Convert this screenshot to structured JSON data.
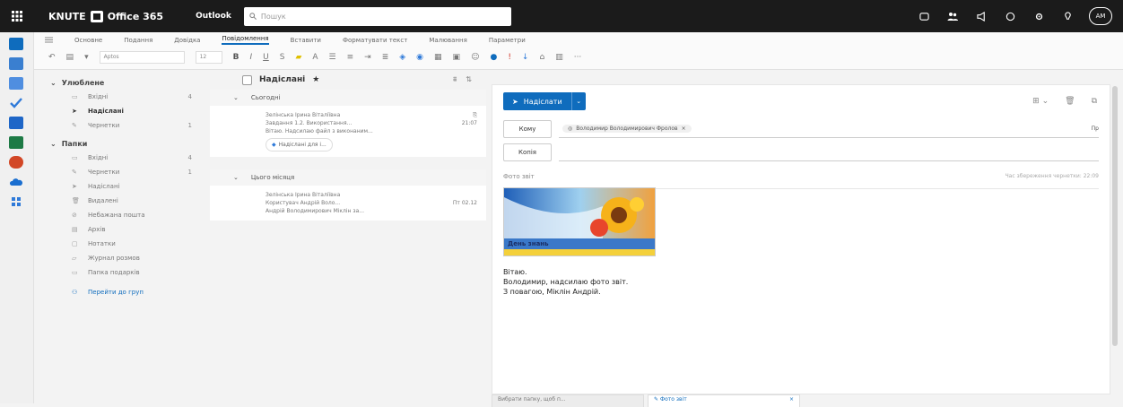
{
  "header": {
    "brand": "KNUTE",
    "suite": "Office 365",
    "app": "Outlook",
    "search_placeholder": "Пошук",
    "avatar": "AM"
  },
  "ribbon": {
    "tabs": [
      "Основне",
      "Подання",
      "Довідка",
      "Повідомлення",
      "Вставити",
      "Форматувати текст",
      "Малювання",
      "Параметри"
    ],
    "active_tab": "Повідомлення",
    "font": "Aptos",
    "size": "12"
  },
  "folders": {
    "favorites_header": "Улюблене",
    "favorites": [
      {
        "label": "Вхідні",
        "count": "4",
        "icon": "inbox-icon"
      },
      {
        "label": "Надіслані",
        "count": "",
        "icon": "send-icon"
      },
      {
        "label": "Чернетки",
        "count": "1",
        "icon": "draft-icon"
      }
    ],
    "folders_header": "Папки",
    "folders": [
      {
        "label": "Вхідні",
        "count": "4",
        "icon": "inbox-icon"
      },
      {
        "label": "Чернетки",
        "count": "1",
        "icon": "draft-icon"
      },
      {
        "label": "Надіслані",
        "count": "",
        "icon": "send-icon"
      },
      {
        "label": "Видалені",
        "count": "",
        "icon": "trash-icon"
      },
      {
        "label": "Небажана пошта",
        "count": "",
        "icon": "junk-icon"
      },
      {
        "label": "Архів",
        "count": "",
        "icon": "archive-icon"
      },
      {
        "label": "Нотатки",
        "count": "",
        "icon": "notes-icon"
      },
      {
        "label": "Журнал розмов",
        "count": "",
        "icon": "chat-icon"
      },
      {
        "label": "Папка подарків",
        "count": "",
        "icon": "folder-icon"
      }
    ],
    "go_to_groups": "Перейти до груп"
  },
  "message_list": {
    "title": "Надіслані",
    "groups": [
      {
        "label": "Сьогодні",
        "messages": [
          {
            "from": "Зелінська Ірина Віталіївна",
            "subject": "Завдання 1.2. Використання...",
            "time": "21:07",
            "preview": "Вітаю. Надсилаю файл з виконаним...",
            "attachment": "Надіслані для і..."
          }
        ]
      },
      {
        "label": "Цього місяця",
        "messages": [
          {
            "from": "Зелінська Ірина Віталіївна",
            "subject": "Користувач Андрій Воло...",
            "time": "Пт 02.12",
            "preview": "Андрій Володимирович Міклін за...",
            "attachment": ""
          }
        ]
      }
    ]
  },
  "compose": {
    "send_label": "Надіслати",
    "to_label": "Кому",
    "cc_label": "Копія",
    "recipient": "Володимир Володимирович Фролов",
    "cc_bcc": "Пр",
    "subject": "Фото звіт",
    "draft_status": "Час збереження чернетки: 22:09",
    "image_caption": "День знань",
    "body_lines": [
      "Вітаю.",
      "Володимир, надсилаю фото звіт.",
      "З повагою, Міклін Андрій."
    ]
  },
  "bottom_tabs": [
    {
      "label": "Вибрати папку, щоб п...",
      "active": false
    },
    {
      "label": "Фото звіт",
      "active": true
    }
  ],
  "colors": {
    "accent": "#0f6cbd",
    "header_bg": "#1b1b1b"
  }
}
